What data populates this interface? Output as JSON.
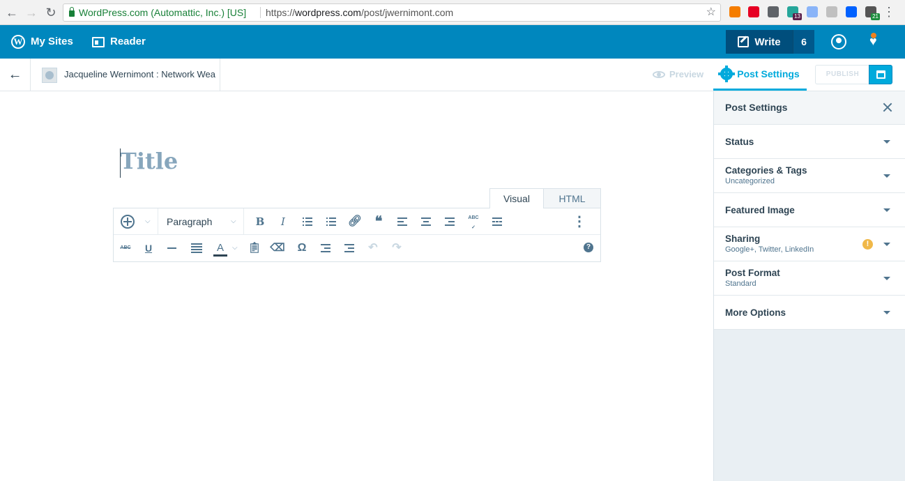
{
  "browser": {
    "secure_label": "WordPress.com (Automattic, Inc.) [US]",
    "url_scheme": "https://",
    "url_host": "wordpress.com",
    "url_path": "/post/jwernimont.com",
    "extensions": [
      {
        "name": "blogger-ext-icon",
        "color": "#f57d00"
      },
      {
        "name": "pinterest-ext-icon",
        "color": "#e60023"
      },
      {
        "name": "info-ext-icon",
        "color": "#5f6368"
      },
      {
        "name": "timer-ext-icon",
        "color": "#26a69a",
        "badge": "13",
        "badge_color": "#5b1f4a"
      },
      {
        "name": "docs-ext-icon",
        "color": "#8ab4f8"
      },
      {
        "name": "bookmark-ext-icon",
        "color": "#c0c0c0"
      },
      {
        "name": "dropbox-ext-icon",
        "color": "#0061ff"
      },
      {
        "name": "document-ext-icon",
        "color": "#555555",
        "badge": "21",
        "badge_color": "#1e8e3e"
      }
    ]
  },
  "masterbar": {
    "my_sites": "My Sites",
    "reader": "Reader",
    "write": "Write",
    "write_count": "6"
  },
  "editor_bar": {
    "site_title": "Jacqueline Wernimont : Network Wea",
    "preview": "Preview",
    "post_settings_tab": "Post Settings",
    "publish": "PUBLISH"
  },
  "editor": {
    "title_placeholder": "Title",
    "mode_tabs": [
      "Visual",
      "HTML"
    ],
    "format_select": "Paragraph",
    "row1_tools": [
      "bold",
      "italic",
      "bullet-list",
      "numbered-list",
      "link",
      "blockquote",
      "align-left",
      "align-center",
      "align-right",
      "spellcheck",
      "read-more",
      "more"
    ],
    "row2_tools": [
      "strikethrough",
      "underline",
      "horizontal-rule",
      "justify",
      "text-color",
      "paste-text",
      "clear-formatting",
      "special-character",
      "outdent",
      "indent",
      "undo",
      "redo",
      "help"
    ],
    "glyphs": {
      "bold": "B",
      "italic": "I",
      "underline": "U",
      "text_color": "A",
      "omega": "Ω",
      "strike": "ABC",
      "spell": "ABC",
      "quote": "❝",
      "help": "?"
    }
  },
  "sidebar": {
    "header": "Post Settings",
    "items": [
      {
        "title": "Status",
        "subtitle": ""
      },
      {
        "title": "Categories & Tags",
        "subtitle": "Uncategorized"
      },
      {
        "title": "Featured Image",
        "subtitle": ""
      },
      {
        "title": "Sharing",
        "subtitle": "Google+, Twitter, LinkedIn",
        "warning": "!"
      },
      {
        "title": "Post Format",
        "subtitle": "Standard"
      },
      {
        "title": "More Options",
        "subtitle": ""
      }
    ]
  },
  "colors": {
    "masterbar": "#0087be",
    "accent": "#00aadc",
    "write_button": "#004e7c",
    "sidebar_bg": "#e9eff3",
    "warning": "#f0b849"
  }
}
